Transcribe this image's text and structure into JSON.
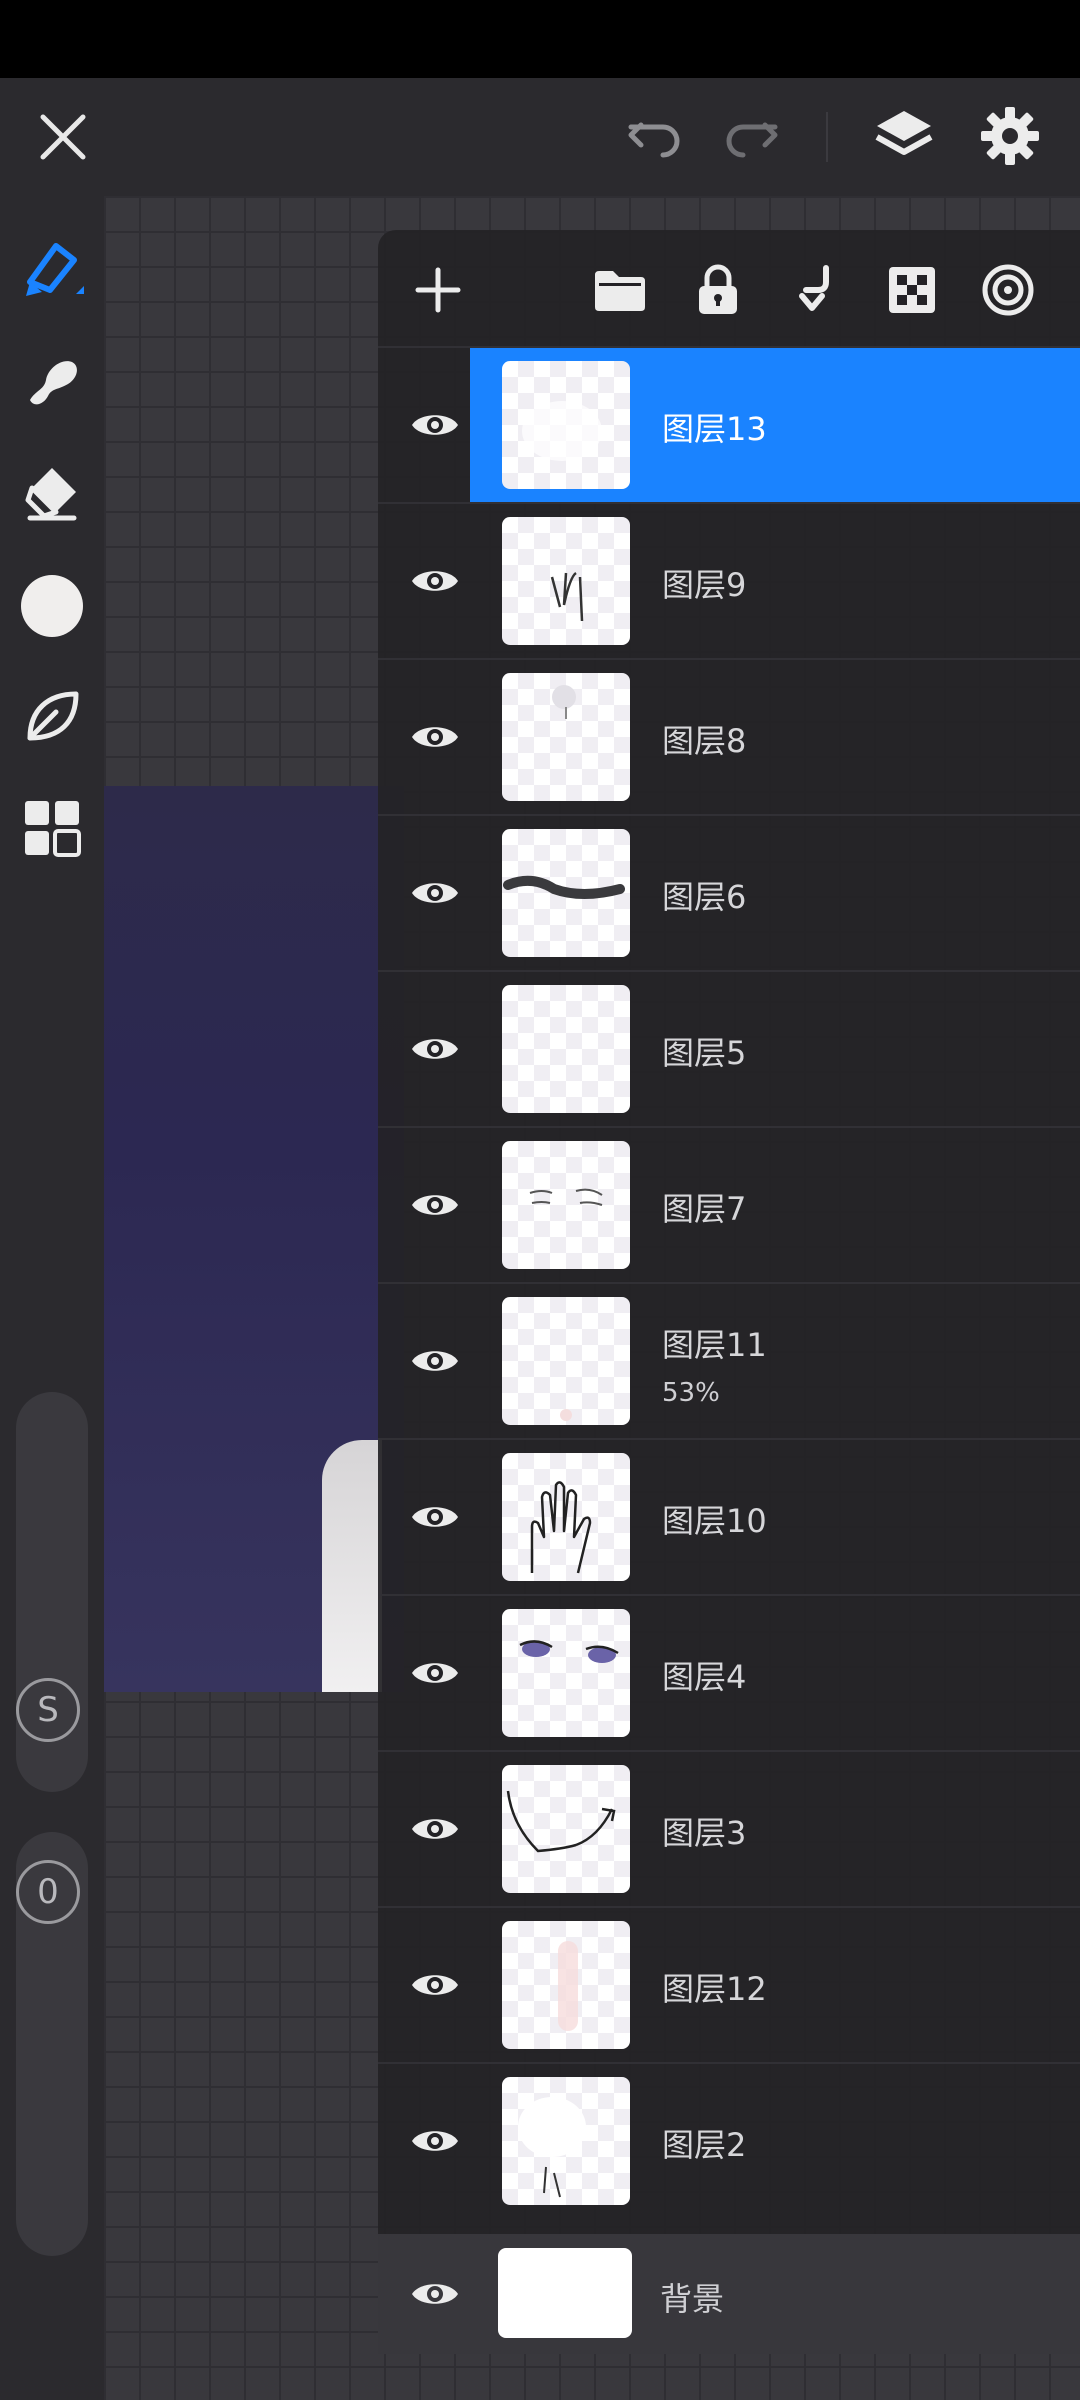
{
  "topbar": {
    "icons": [
      "close-icon",
      "undo-icon",
      "redo-icon",
      "layers-icon",
      "settings-icon"
    ]
  },
  "toolbar": {
    "tools": [
      "brush-icon",
      "smudge-icon",
      "eraser-icon",
      "color-swatch",
      "leaf-icon",
      "grid-icon"
    ],
    "color_swatch": "#f0eeed",
    "size_slider_label": "S",
    "opacity_slider_label": "0"
  },
  "layers_panel": {
    "header_icons": [
      "add-icon",
      "folder-icon",
      "lock-icon",
      "merge-down-icon",
      "transparency-icon",
      "reference-icon"
    ],
    "layers": [
      {
        "name": "图层13",
        "selected": true
      },
      {
        "name": "图层9"
      },
      {
        "name": "图层8"
      },
      {
        "name": "图层6"
      },
      {
        "name": "图层5"
      },
      {
        "name": "图层7"
      },
      {
        "name": "图层11",
        "opacity": "53%"
      },
      {
        "name": "图层10"
      },
      {
        "name": "图层4"
      },
      {
        "name": "图层3"
      },
      {
        "name": "图层12"
      },
      {
        "name": "图层2"
      }
    ],
    "background_layer": {
      "name": "背景"
    }
  },
  "colors": {
    "accent": "#1a83ff",
    "app_background": "#2b2a2e",
    "panel_background": "#232226"
  }
}
